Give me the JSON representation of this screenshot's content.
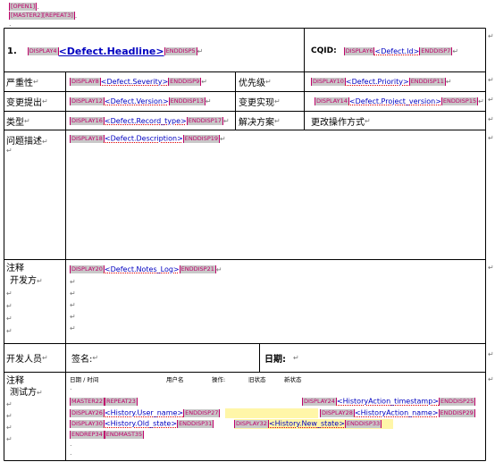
{
  "header_tags": {
    "open": "[OPEN1]",
    "master_repeat": "[MASTER2][REPEAT3]"
  },
  "para_mark": "↵",
  "small_mark": ".",
  "row1": {
    "num": "1.",
    "tag_display": "DISPLAY4",
    "headline": "<Defect.Headline>",
    "tag_end": "ENDDISP5",
    "cqid_label": "CQID:",
    "cqid_tag": "DISPLAY6",
    "cqid_field": "<Defect.Id>",
    "cqid_end": "ENDDISP7"
  },
  "row2": {
    "label": "严重性",
    "tag": "DISPLAY8",
    "field": "<Defect.Severity>",
    "end": "ENDDISP9",
    "label2": "优先级",
    "tag2": "DISPLAY10",
    "field2": "<Defect.Priority>",
    "end2": "ENDDISP11"
  },
  "row3": {
    "label": "变更提出",
    "tag": "DISPLAY12",
    "field": "<Defect.Version>",
    "end": "ENDDISP13",
    "label2": "变更实现",
    "tag2": "DISPLAY14",
    "field2": "<Defect.Project_version>",
    "end2": "ENDDISP15"
  },
  "row4": {
    "label": "类型",
    "tag": "DISPLAY16",
    "field": "<Defect.Record_type>",
    "end": "ENDDISP17",
    "label2": "解决方案",
    "value2": "更改操作方式"
  },
  "row5": {
    "label": "问题描述",
    "tag": "DISPLAY18",
    "field": "<Defect.Description>",
    "end": "ENDDISP19"
  },
  "row6": {
    "label1": "注释",
    "label2": "开发方",
    "tag": "DISPLAY20",
    "field": "<Defect.Notes_Log>",
    "end": "ENDDISP21"
  },
  "row7": {
    "label": "开发人员",
    "sign_label": "签名:",
    "date_label": "日期:"
  },
  "row8": {
    "label1": "注释",
    "label2": "测试方",
    "col_date": "日期 / 时间",
    "col_user": "用户名",
    "col_op": "操作:",
    "col_old": "旧状态",
    "col_new": "新状态",
    "master_tag": "MASTER22",
    "repeat_tag": "REPEAT23",
    "disp24": "DISPLAY24",
    "ts_field": "<HistoryAction_timestamp>",
    "end25": "ENDDISP25",
    "disp26": "DISPLAY26",
    "user_field": "<History.User_name>",
    "end27": "ENDDISP27",
    "disp28": "DISPLAY28",
    "action_field": "<HistoryAction_name>",
    "end29": "ENDDISP29",
    "disp30": "DISPLAY30",
    "old_field": "<History.Old_state>",
    "end31": "ENDDISP31",
    "disp32": "DISPLAY32",
    "new_field": "<History.New_state>",
    "end33": "ENDDISP33",
    "endrep": "ENDREP34",
    "endmast": "ENDMAST35"
  }
}
